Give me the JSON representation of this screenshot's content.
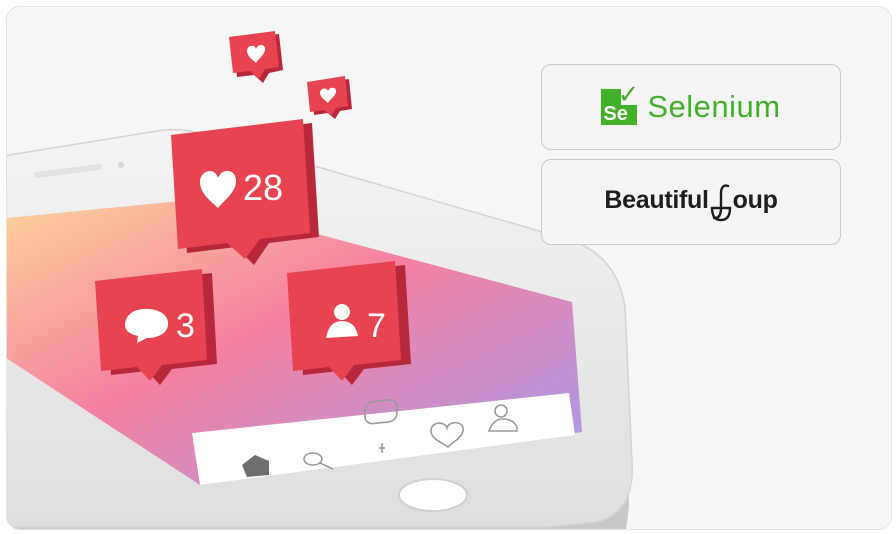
{
  "notifications": {
    "likes": {
      "icon": "heart-icon",
      "count": "28"
    },
    "comments": {
      "icon": "comment-icon",
      "count": "3"
    },
    "followers": {
      "icon": "user-icon",
      "count": "7"
    }
  },
  "phone_nav": {
    "icons": [
      "home-icon",
      "search-icon",
      "plus-icon",
      "heart-icon",
      "profile-icon"
    ]
  },
  "logos": {
    "selenium": {
      "mark": "Se",
      "name": "Selenium",
      "color": "#43b02a"
    },
    "beautifulsoup": {
      "text_before": "Beautiful",
      "text_after": "oup"
    }
  },
  "colors": {
    "notification_red": "#e8444f",
    "notification_side": "#b7293a",
    "screen_gradient": [
      "#fcc28b",
      "#f47c8e",
      "#a995ef"
    ]
  }
}
